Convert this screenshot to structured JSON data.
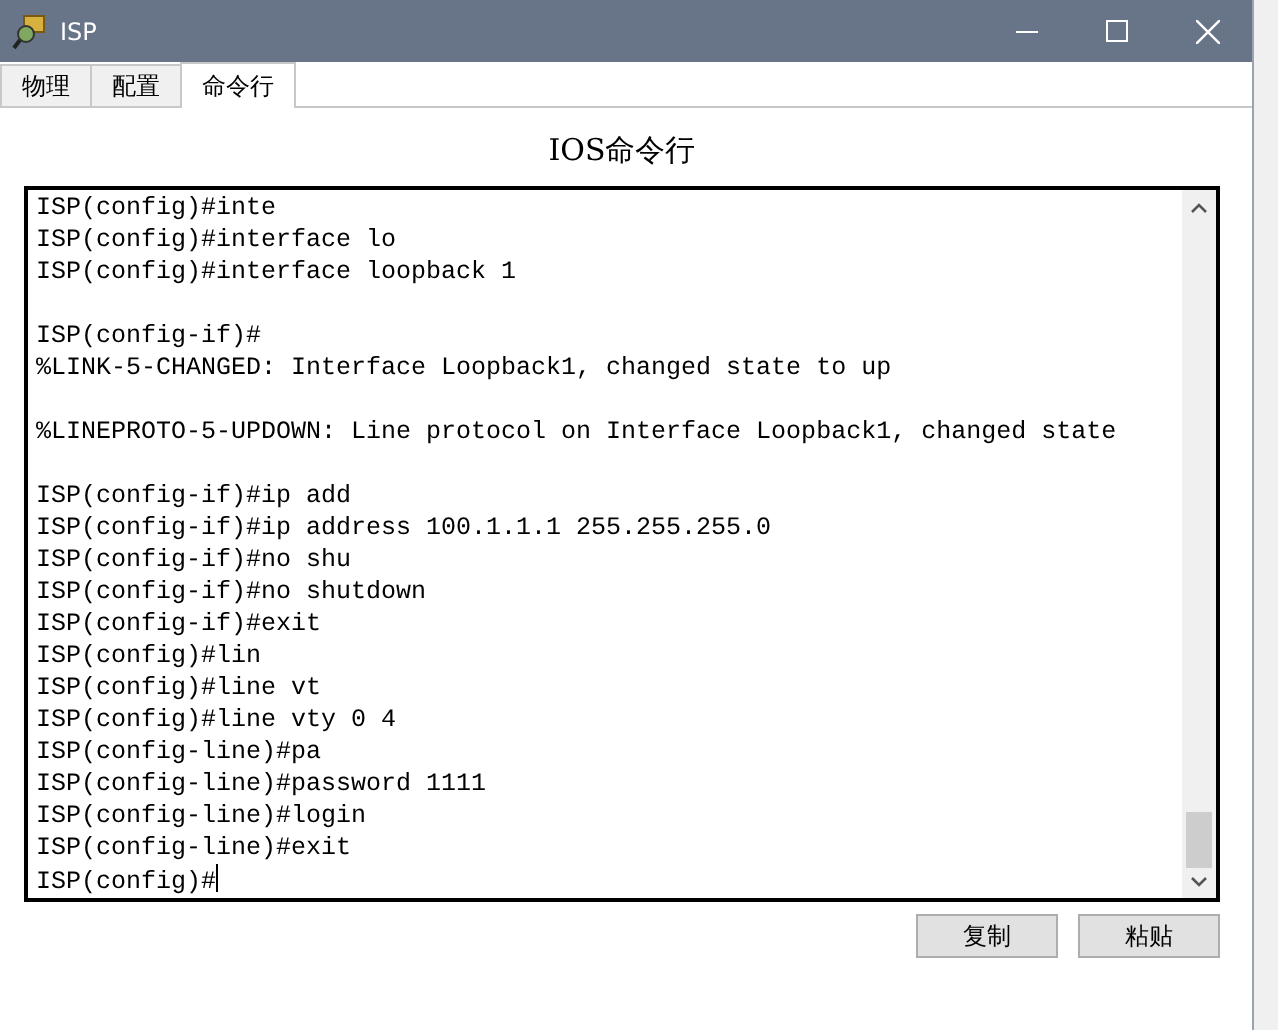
{
  "window": {
    "title": "ISP"
  },
  "tabs": [
    {
      "label": "物理",
      "selected": false
    },
    {
      "label": "配置",
      "selected": false
    },
    {
      "label": "命令行",
      "selected": true
    }
  ],
  "heading": "IOS命令行",
  "terminal": {
    "lines": [
      {
        "kind": "text",
        "text": "ISP(config)#inte"
      },
      {
        "kind": "text",
        "text": "ISP(config)#interface lo"
      },
      {
        "kind": "text",
        "text": "ISP(config)#interface loopback 1"
      },
      {
        "kind": "blank"
      },
      {
        "kind": "text",
        "text": "ISP(config-if)#"
      },
      {
        "kind": "text",
        "text": "%LINK-5-CHANGED: Interface Loopback1, changed state to up"
      },
      {
        "kind": "blank"
      },
      {
        "kind": "text",
        "text": "%LINEPROTO-5-UPDOWN: Line protocol on Interface Loopback1, changed state"
      },
      {
        "kind": "blank"
      },
      {
        "kind": "text",
        "text": "ISP(config-if)#ip add"
      },
      {
        "kind": "text",
        "text": "ISP(config-if)#ip address 100.1.1.1 255.255.255.0"
      },
      {
        "kind": "text",
        "text": "ISP(config-if)#no shu"
      },
      {
        "kind": "text",
        "text": "ISP(config-if)#no shutdown"
      },
      {
        "kind": "text",
        "text": "ISP(config-if)#exit"
      },
      {
        "kind": "text",
        "text": "ISP(config)#lin"
      },
      {
        "kind": "text",
        "text": "ISP(config)#line vt"
      },
      {
        "kind": "text",
        "text": "ISP(config)#line vty 0 4"
      },
      {
        "kind": "text",
        "text": "ISP(config-line)#pa"
      },
      {
        "kind": "text",
        "text": "ISP(config-line)#password 1111"
      },
      {
        "kind": "text",
        "text": "ISP(config-line)#login"
      },
      {
        "kind": "text",
        "text": "ISP(config-line)#exit"
      },
      {
        "kind": "prompt",
        "text": "ISP(config)#"
      }
    ]
  },
  "buttons": [
    "复制",
    "粘贴"
  ]
}
